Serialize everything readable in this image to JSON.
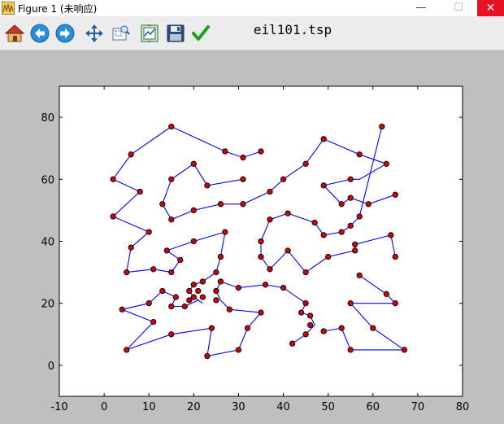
{
  "window": {
    "title": "Figure 1 (未响应)",
    "minimize_glyph": "—",
    "maximize_glyph": "☐",
    "close_glyph": "✕"
  },
  "toolbar": {
    "buttons": [
      {
        "name": "home-button",
        "icon": "home-icon"
      },
      {
        "name": "back-button",
        "icon": "arrow-left-icon"
      },
      {
        "name": "forward-button",
        "icon": "arrow-right-icon"
      },
      {
        "name": "pan-button",
        "icon": "move-icon"
      },
      {
        "name": "zoom-button",
        "icon": "zoom-rect-icon"
      },
      {
        "name": "configure-subplots-button",
        "icon": "subplots-icon"
      },
      {
        "name": "save-button",
        "icon": "floppy-icon"
      },
      {
        "name": "edit-axes-button",
        "icon": "checkmark-icon"
      }
    ]
  },
  "figure": {
    "title": "eil101.tsp"
  },
  "chart_data": {
    "type": "line",
    "title": "eil101.tsp",
    "xlabel": "",
    "ylabel": "",
    "xlim": [
      -10,
      80
    ],
    "ylim": [
      -10,
      90
    ],
    "xticks": [
      -10,
      0,
      10,
      20,
      30,
      40,
      50,
      60,
      70,
      80
    ],
    "yticks": [
      0,
      20,
      40,
      60,
      80
    ],
    "grid": false,
    "line_color": "#0000ff",
    "marker_face": "#cc0000",
    "marker_edge": "#000000",
    "segments": [
      {
        "name": "left",
        "x": [
          35,
          31,
          27,
          15,
          6,
          2,
          8,
          2,
          10,
          6,
          5,
          11,
          15,
          17,
          14,
          20,
          27,
          26,
          25,
          22,
          20,
          19,
          20,
          22,
          21,
          18,
          15,
          16,
          13,
          10,
          4,
          11,
          5,
          15,
          24,
          23,
          30,
          32,
          35,
          28,
          26,
          25,
          26,
          30,
          36,
          40,
          45,
          44,
          46,
          47,
          45,
          42
        ],
        "y": [
          69,
          67,
          69,
          77,
          68,
          60,
          56,
          48,
          43,
          38,
          30,
          31,
          30,
          34,
          37,
          40,
          43,
          35,
          30,
          27,
          26,
          24,
          22,
          20,
          21,
          19,
          19,
          22,
          24,
          20,
          18,
          14,
          5,
          10,
          12,
          3,
          5,
          12,
          17,
          18,
          21,
          24,
          27,
          25,
          26,
          25,
          20,
          17,
          16,
          13,
          10,
          7
        ]
      },
      {
        "name": "middle",
        "x": [
          31,
          23,
          20,
          16,
          15,
          13,
          15,
          20,
          26,
          31,
          37,
          40,
          45,
          49,
          57,
          63,
          57,
          55,
          49,
          53,
          55,
          59,
          65
        ],
        "y": [
          60,
          58,
          65,
          61,
          60,
          52,
          47,
          50,
          52,
          52,
          56,
          60,
          65,
          73,
          68,
          65,
          60,
          60,
          58,
          52,
          54,
          52,
          55
        ]
      },
      {
        "name": "right-upper",
        "x": [
          62,
          57,
          57,
          55,
          53,
          49,
          47,
          41,
          37,
          35,
          35,
          37,
          41,
          45,
          50,
          56,
          56,
          64,
          65
        ],
        "y": [
          77,
          48,
          48,
          45,
          43,
          42,
          46,
          49,
          47,
          40,
          35,
          31,
          37,
          30,
          35,
          37,
          39,
          42,
          35
        ]
      },
      {
        "name": "right-lower",
        "x": [
          57,
          63,
          65,
          55,
          60,
          67,
          55,
          53,
          49
        ],
        "y": [
          29,
          23,
          20,
          20,
          12,
          5,
          5,
          12,
          11
        ]
      }
    ],
    "points": [
      {
        "x": 35,
        "y": 69
      },
      {
        "x": 31,
        "y": 67
      },
      {
        "x": 27,
        "y": 69
      },
      {
        "x": 15,
        "y": 77
      },
      {
        "x": 6,
        "y": 68
      },
      {
        "x": 2,
        "y": 60
      },
      {
        "x": 8,
        "y": 56
      },
      {
        "x": 2,
        "y": 48
      },
      {
        "x": 10,
        "y": 43
      },
      {
        "x": 6,
        "y": 38
      },
      {
        "x": 5,
        "y": 30
      },
      {
        "x": 11,
        "y": 31
      },
      {
        "x": 15,
        "y": 30
      },
      {
        "x": 17,
        "y": 34
      },
      {
        "x": 14,
        "y": 37
      },
      {
        "x": 20,
        "y": 40
      },
      {
        "x": 27,
        "y": 43
      },
      {
        "x": 26,
        "y": 35
      },
      {
        "x": 25,
        "y": 30
      },
      {
        "x": 22,
        "y": 27
      },
      {
        "x": 20,
        "y": 26
      },
      {
        "x": 19,
        "y": 24
      },
      {
        "x": 21,
        "y": 24
      },
      {
        "x": 20,
        "y": 22
      },
      {
        "x": 22,
        "y": 22
      },
      {
        "x": 19,
        "y": 21
      },
      {
        "x": 18,
        "y": 19
      },
      {
        "x": 15,
        "y": 19
      },
      {
        "x": 16,
        "y": 22
      },
      {
        "x": 13,
        "y": 24
      },
      {
        "x": 10,
        "y": 20
      },
      {
        "x": 4,
        "y": 18
      },
      {
        "x": 11,
        "y": 14
      },
      {
        "x": 5,
        "y": 5
      },
      {
        "x": 15,
        "y": 10
      },
      {
        "x": 24,
        "y": 12
      },
      {
        "x": 23,
        "y": 3
      },
      {
        "x": 30,
        "y": 5
      },
      {
        "x": 32,
        "y": 12
      },
      {
        "x": 35,
        "y": 17
      },
      {
        "x": 28,
        "y": 18
      },
      {
        "x": 25,
        "y": 21
      },
      {
        "x": 25,
        "y": 24
      },
      {
        "x": 26,
        "y": 27
      },
      {
        "x": 30,
        "y": 25
      },
      {
        "x": 36,
        "y": 26
      },
      {
        "x": 40,
        "y": 25
      },
      {
        "x": 45,
        "y": 20
      },
      {
        "x": 44,
        "y": 17
      },
      {
        "x": 46,
        "y": 16
      },
      {
        "x": 46,
        "y": 13
      },
      {
        "x": 45,
        "y": 10
      },
      {
        "x": 42,
        "y": 7
      },
      {
        "x": 31,
        "y": 60
      },
      {
        "x": 23,
        "y": 58
      },
      {
        "x": 20,
        "y": 65
      },
      {
        "x": 15,
        "y": 60
      },
      {
        "x": 13,
        "y": 52
      },
      {
        "x": 15,
        "y": 47
      },
      {
        "x": 20,
        "y": 50
      },
      {
        "x": 26,
        "y": 52
      },
      {
        "x": 31,
        "y": 52
      },
      {
        "x": 37,
        "y": 56
      },
      {
        "x": 40,
        "y": 60
      },
      {
        "x": 45,
        "y": 65
      },
      {
        "x": 49,
        "y": 73
      },
      {
        "x": 57,
        "y": 68
      },
      {
        "x": 63,
        "y": 65
      },
      {
        "x": 55,
        "y": 60
      },
      {
        "x": 49,
        "y": 58
      },
      {
        "x": 53,
        "y": 52
      },
      {
        "x": 55,
        "y": 54
      },
      {
        "x": 59,
        "y": 52
      },
      {
        "x": 65,
        "y": 55
      },
      {
        "x": 62,
        "y": 77
      },
      {
        "x": 57,
        "y": 48
      },
      {
        "x": 55,
        "y": 45
      },
      {
        "x": 53,
        "y": 43
      },
      {
        "x": 49,
        "y": 42
      },
      {
        "x": 47,
        "y": 46
      },
      {
        "x": 41,
        "y": 49
      },
      {
        "x": 37,
        "y": 47
      },
      {
        "x": 35,
        "y": 40
      },
      {
        "x": 35,
        "y": 35
      },
      {
        "x": 37,
        "y": 31
      },
      {
        "x": 41,
        "y": 37
      },
      {
        "x": 45,
        "y": 30
      },
      {
        "x": 50,
        "y": 35
      },
      {
        "x": 56,
        "y": 37
      },
      {
        "x": 56,
        "y": 39
      },
      {
        "x": 64,
        "y": 42
      },
      {
        "x": 65,
        "y": 35
      },
      {
        "x": 57,
        "y": 29
      },
      {
        "x": 63,
        "y": 23
      },
      {
        "x": 65,
        "y": 20
      },
      {
        "x": 55,
        "y": 20
      },
      {
        "x": 60,
        "y": 12
      },
      {
        "x": 67,
        "y": 5
      },
      {
        "x": 55,
        "y": 5
      },
      {
        "x": 53,
        "y": 12
      },
      {
        "x": 49,
        "y": 11
      }
    ]
  }
}
